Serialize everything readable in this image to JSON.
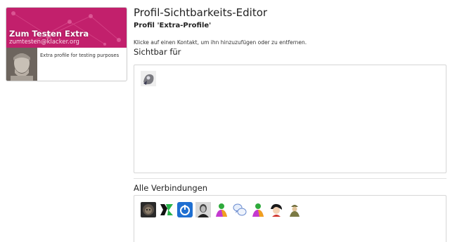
{
  "profile_card": {
    "name": "Zum Testen Extra",
    "address": "zumtesten@klacker.org",
    "description": "Extra profile for testing purposes",
    "header_color": "#c2206c"
  },
  "editor": {
    "title": "Profil-Sichtbarkeits-Editor",
    "profile_label": "Profil 'Extra-Profile'",
    "hint": "Klicke auf einen Kontakt, um ihn hinzuzufügen oder zu entfernen.",
    "visible_heading": "Sichtbar für",
    "all_heading": "Alle Verbindungen"
  },
  "visible_contacts": [
    {
      "icon": "grey-creature-avatar-icon"
    }
  ],
  "all_connections": [
    {
      "icon": "dark-lion-avatar-icon"
    },
    {
      "icon": "green-x-logo-icon"
    },
    {
      "icon": "blue-power-button-icon"
    },
    {
      "icon": "bw-portrait-avatar-icon"
    },
    {
      "icon": "colorful-person-avatar-icon"
    },
    {
      "icon": "speech-bubbles-avatar-icon"
    },
    {
      "icon": "colorful-person-avatar-icon"
    },
    {
      "icon": "cartoon-girl-avatar-icon"
    },
    {
      "icon": "soldier-avatar-icon"
    }
  ]
}
